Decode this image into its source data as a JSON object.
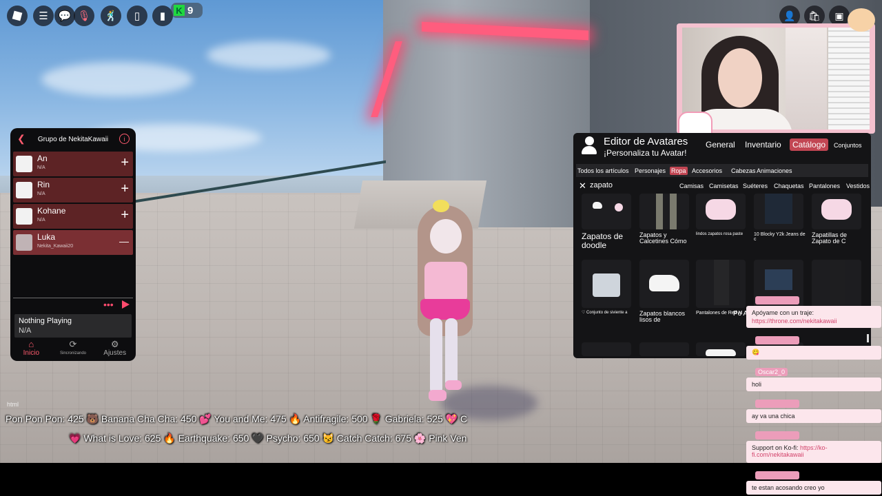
{
  "topbar": {
    "badge_count": "9"
  },
  "group_panel": {
    "title": "Grupo de NekitaKawaii",
    "members": [
      {
        "name": "An",
        "status": "N/A",
        "action": "+"
      },
      {
        "name": "Rin",
        "status": "N/A",
        "action": "+"
      },
      {
        "name": "Kohane",
        "status": "N/A",
        "action": "+"
      },
      {
        "name": "Luka",
        "status": "Nekita_Kawaii20",
        "action": "—"
      }
    ],
    "now_playing": {
      "title": "Nothing Playing",
      "subtitle": "N/A"
    },
    "tabs": [
      {
        "label": "Inicio"
      },
      {
        "label": "Sincronizando"
      },
      {
        "label": "Ajustes"
      }
    ]
  },
  "avatar_editor": {
    "title": "Editor de Avatares",
    "subtitle": "¡Personaliza tu Avatar!",
    "nav": [
      "General",
      "Inventario",
      "Catálogo",
      "Conjuntos"
    ],
    "categories": [
      "Todos los artículos",
      "Personajes",
      "Ropa",
      "Accesorios",
      "Cabezas",
      "Animaciones"
    ],
    "search_query": "zapato",
    "subcategories": [
      "Camisas",
      "Camisetas",
      "Suéteres",
      "Chaquetas",
      "Pantalones",
      "Vestidos"
    ],
    "items": [
      "Zapatos de doodle",
      "Zapatos y Calcetines Cómo",
      "lindos zapatos rosa paste",
      "10 Blocky Y2k Jeans de c",
      "Zapatillas de Zapato de C",
      "♡ Conjunto de siviente a",
      "Zapatos blancos lisos de",
      "Pantalones de Red M",
      "Po Ass"
    ]
  },
  "chat": {
    "messages": [
      {
        "user": "",
        "text": "Apóyame con un traje:",
        "link": "https://throne.com/nekitakawaii"
      },
      {
        "user": "",
        "text": "😋",
        "link": ""
      },
      {
        "user": "Oscar2_0",
        "text": "holi",
        "link": ""
      },
      {
        "user": "",
        "text": "ay va una chica",
        "link": ""
      },
      {
        "user": "",
        "text": "Support on Ko-fi: ",
        "link": "https://ko-fi.com/nekitakawaii"
      },
      {
        "user": "",
        "text": "te estan acosando creo yo",
        "link": ""
      }
    ]
  },
  "ticker": {
    "line1": "Pon Pon Pon: 425 🐻 Banana Cha Cha: 450 💕 You and Me: 475 🔥 Antifragile: 500 🌹 Gabriela: 525 💖 C",
    "line2": "💗 What is Love: 625 🔥 Earthquake: 650 🖤 Psycho: 650 😼 Catch Catch: 675 🌸 Pink Ven"
  },
  "overlay_label": "html"
}
